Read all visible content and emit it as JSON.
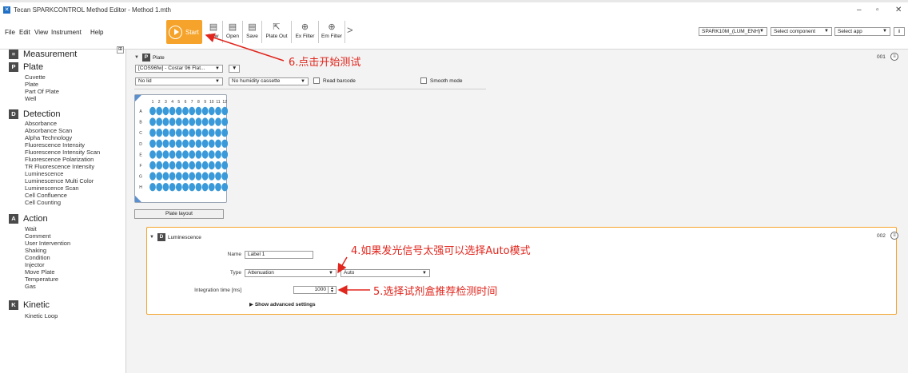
{
  "window": {
    "title": "Tecan SPARKCONTROL Method Editor - Method 1.mth",
    "minimize": "–",
    "restore": "▫",
    "close": "✕"
  },
  "menu": [
    "File",
    "Edit",
    "View",
    "Instrument",
    "Help"
  ],
  "toolbar": {
    "start_label": "Start",
    "buttons": [
      {
        "label": "New",
        "icon": "new-method-icon"
      },
      {
        "label": "Open",
        "icon": "open-method-icon"
      },
      {
        "label": "Save",
        "icon": "save-method-icon"
      },
      {
        "label": "Plate Out",
        "icon": "plate-out-icon"
      },
      {
        "label": "Ex Filter",
        "icon": "ex-filter-icon"
      },
      {
        "label": "Em Filter",
        "icon": "em-filter-icon"
      }
    ],
    "more": ">",
    "instrument": "SPARK10M_(LUM_ENH)",
    "component": "Select component",
    "app": "Select app",
    "info": "i"
  },
  "sidebar": {
    "pin": "⊞",
    "sections": [
      {
        "badge": "≡",
        "label": "Measurement",
        "items": []
      },
      {
        "badge": "P",
        "label": "Plate",
        "items": [
          "Cuvette",
          "Plate",
          "Part Of Plate",
          "Well"
        ]
      },
      {
        "badge": "D",
        "label": "Detection",
        "items": [
          "Absorbance",
          "Absorbance Scan",
          "Alpha Technology",
          "Fluorescence Intensity",
          "Fluorescence Intensity Scan",
          "Fluorescence Polarization",
          "TR Fluorescence Intensity",
          "Luminescence",
          "Luminescence Multi Color",
          "Luminescence Scan",
          "Cell Confluence",
          "Cell Counting"
        ]
      },
      {
        "badge": "A",
        "label": "Action",
        "items": [
          "Wait",
          "Comment",
          "User Intervention",
          "Shaking",
          "Condition",
          "Injector",
          "Move Plate",
          "Temperature",
          "Gas"
        ]
      },
      {
        "badge": "K",
        "label": "Kinetic",
        "items": [
          "Kinetic Loop"
        ]
      }
    ]
  },
  "plate_step": {
    "badge": "P",
    "title": "Plate",
    "number": "001",
    "plate_type": "[COS96fw] - Costar 96 Flat...",
    "lid": "No lid",
    "humidity": "No humidity cassette",
    "read_barcode": "Read barcode",
    "smooth_mode": "Smooth mode",
    "columns": [
      "1",
      "2",
      "3",
      "4",
      "5",
      "6",
      "7",
      "8",
      "9",
      "10",
      "11",
      "12"
    ],
    "rows": [
      "A",
      "B",
      "C",
      "D",
      "E",
      "F",
      "G",
      "H"
    ],
    "well_color": "#3a9ad9",
    "layout_button": "Plate layout"
  },
  "lum_step": {
    "badge": "D",
    "title": "Luminescence",
    "number": "002",
    "name_label": "Name",
    "name_value": "Label 1",
    "type_label": "Type",
    "type_value": "Attenuation",
    "mode_value": "Auto",
    "time_label": "Integration time [ms]",
    "time_value": "1000",
    "advanced": "Show advanced settings"
  },
  "annotations": {
    "start": "6.点击开始测试",
    "auto": "4.如果发光信号太强可以选择Auto模式",
    "time": "5.选择试剂盒推荐检测时间",
    "color": "#e0261d"
  },
  "accent_color": "#f5a32a"
}
